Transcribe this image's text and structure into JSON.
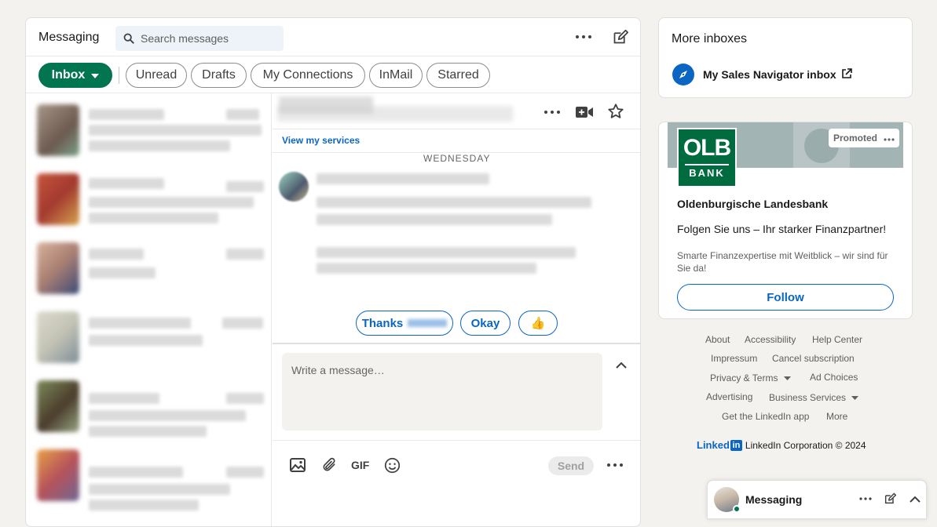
{
  "header": {
    "title": "Messaging",
    "search_placeholder": "Search messages"
  },
  "filters": [
    {
      "label": "Inbox",
      "active": true
    },
    {
      "label": "Unread"
    },
    {
      "label": "Drafts"
    },
    {
      "label": "My Connections"
    },
    {
      "label": "InMail"
    },
    {
      "label": "Starred"
    }
  ],
  "thread": {
    "services_link": "View my services",
    "day_label": "WEDNESDAY",
    "quick_replies": [
      "Thanks",
      "Okay",
      "👍"
    ],
    "composer_placeholder": "Write a message…",
    "gif_label": "GIF",
    "send_label": "Send"
  },
  "more_inboxes": {
    "title": "More inboxes",
    "sales_nav_label": "My Sales Navigator inbox"
  },
  "ad": {
    "promoted_label": "Promoted",
    "logo_top": "OLB",
    "logo_bottom": "BANK",
    "company": "Oldenburgische Landesbank",
    "headline": "Folgen Sie uns – Ihr starker Finanzpartner!",
    "description": "Smarte Finanzexpertise mit Weitblick – wir sind für Sie da!",
    "follow_label": "Follow"
  },
  "footer": {
    "links": [
      "About",
      "Accessibility",
      "Help Center",
      "Impressum",
      "Cancel subscription",
      "Privacy & Terms",
      "Ad Choices",
      "Advertising",
      "Business Services",
      "Get the LinkedIn app",
      "More"
    ],
    "brand_word": "Linked",
    "brand_in": "in",
    "copyright": "LinkedIn Corporation © 2024"
  },
  "mini_messaging": {
    "title": "Messaging"
  },
  "colors": {
    "accent_green": "#01754f",
    "link_blue": "#0a66c2",
    "olb_green": "#006b3f"
  }
}
